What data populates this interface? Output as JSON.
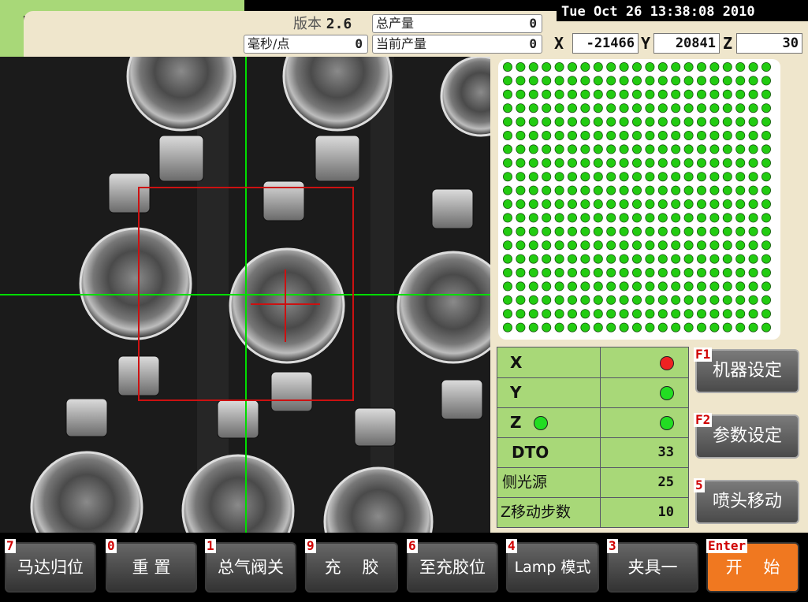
{
  "header": {
    "datetime": "Tue Oct 26 13:38:08 2010",
    "version_label": "版本",
    "version_value": "2.6",
    "ms_per_point_label": "毫秒/点",
    "ms_per_point_value": "0",
    "total_output_label": "总产量",
    "total_output_value": "0",
    "current_output_label": "当前产量",
    "current_output_value": "0"
  },
  "coords": {
    "x_label": "X",
    "x_value": "-21466",
    "y_label": "Y",
    "y_value": "20841",
    "z_label": "Z",
    "z_value": "30"
  },
  "point_grid": {
    "rows": 20,
    "cols": 21,
    "dot_color": "#22cc11"
  },
  "status": {
    "x_label": "X",
    "x_led": "red",
    "y_label": "Y",
    "y_led": "green",
    "z_label": "Z",
    "z_led_a": "green",
    "z_led_b": "green",
    "dto_label": "DTO",
    "dto_value": "33",
    "side_light_label": "侧光源",
    "side_light_value": "25",
    "z_step_label": "Z移动步数",
    "z_step_value": "10"
  },
  "function_buttons": {
    "machine_settings": {
      "key": "F1",
      "label": "机器设定"
    },
    "param_settings": {
      "key": "F2",
      "label": "参数设定"
    },
    "nozzle_move": {
      "key": "5",
      "label": "喷头移动"
    }
  },
  "bottom_buttons": [
    {
      "key": "7",
      "label": "马达归位"
    },
    {
      "key": "0",
      "label": "重 置"
    },
    {
      "key": "1",
      "label": "总气阀关"
    },
    {
      "key": "9",
      "label": "充    胶"
    },
    {
      "key": "6",
      "label": "至充胶位"
    },
    {
      "key": "4",
      "label": "Lamp 模式"
    },
    {
      "key": "3",
      "label": "夹具一"
    },
    {
      "key": "Enter",
      "label": "开    始"
    }
  ],
  "colors": {
    "accent_green": "#a8d878",
    "panel_cream": "#efe6cc",
    "start_orange": "#f07820",
    "crosshair_green": "#00dd00",
    "target_red": "#cc1111"
  }
}
